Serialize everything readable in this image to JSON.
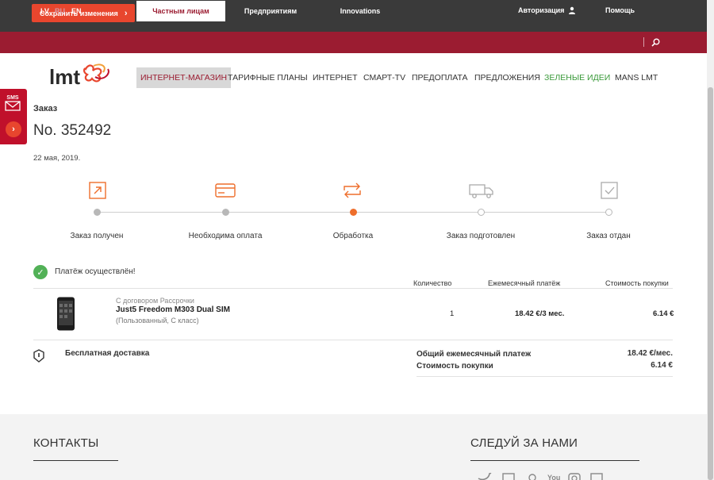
{
  "toolbar": {
    "save_label": "Сохранить изменения",
    "save_chevron": "›"
  },
  "languages": [
    {
      "code": "LV",
      "active": true
    },
    {
      "code": "RU",
      "active": false
    },
    {
      "code": "EN",
      "active": true
    }
  ],
  "top_nav": {
    "tabs": [
      "Частным лицам",
      "Предприятиям",
      "Innovations"
    ],
    "active_tab": "Частным лицам",
    "login": "Авторизация",
    "help": "Помощь"
  },
  "brand": {
    "logo_text": "lmt",
    "colors": {
      "primary": "#9b1c31",
      "accent": "#e8462e",
      "current_step": "#ee6e2c",
      "success": "#52b157",
      "green_link": "#3a9a3a"
    }
  },
  "main_nav": {
    "items": [
      "ИНТЕРНЕТ-МАГАЗИН",
      "ТАРИФНЫЕ ПЛАНЫ",
      "ИНТЕРНЕТ",
      "СМАРТ-TV",
      "ПРЕДОПЛАТА",
      "ПРЕДЛОЖЕНИЯ",
      "ЗЕЛЕНЫЕ ИДЕИ",
      "MANS LMT"
    ],
    "active": "ИНТЕРНЕТ-МАГАЗИН"
  },
  "side_widget": {
    "sms_label": "SMS",
    "arrow": "›"
  },
  "order": {
    "label": "Заказ",
    "number": "No. 352492",
    "date": "22 мая, 2019."
  },
  "steps": [
    {
      "label": "Заказ получен",
      "status": "done",
      "icon": "order-received-icon"
    },
    {
      "label": "Необходима оплата",
      "status": "done",
      "icon": "credit-card-icon"
    },
    {
      "label": "Обработка",
      "status": "current",
      "icon": "processing-arrows-icon"
    },
    {
      "label": "Заказ подготовлен",
      "status": "todo",
      "icon": "delivery-truck-icon"
    },
    {
      "label": "Заказ отдан",
      "status": "todo",
      "icon": "checkbox-icon"
    }
  ],
  "payment": {
    "status": "Платёж осуществлён!",
    "columns": [
      "Количество",
      "Ежемесячный платёж",
      "Стоимость покупки"
    ]
  },
  "product": {
    "contract": "С договором Рассрочки",
    "name": "Just5 Freedom M303 Dual SIM",
    "condition": "(Пользованный, С класс)",
    "quantity": "1",
    "monthly": "18.42 €/3 мес.",
    "price": "6.14 €"
  },
  "shipping": {
    "label": "Бесплатная доставка"
  },
  "summary": {
    "monthly_label": "Общий ежемесячный платеж",
    "monthly_value": "18.42 €/мес.",
    "price_label": "Стоимость покупки",
    "price_value": "6.14 €"
  },
  "footer": {
    "contacts_title": "КОНТАКТЫ",
    "follow_title": "СЛЕДУЙ ЗА НАМИ",
    "social": [
      "twitter-icon",
      "facebook-icon",
      "draugiem-icon",
      "youtube-icon",
      "instagram-icon",
      "linkedin-icon"
    ],
    "youtube_text": "You"
  }
}
